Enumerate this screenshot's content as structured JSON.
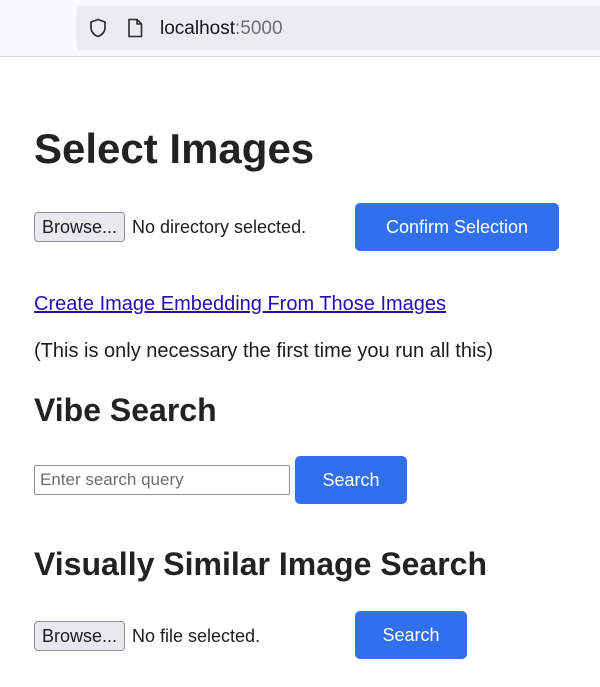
{
  "browser": {
    "url_host": "localhost",
    "url_port": ":5000",
    "icons": [
      "shield-icon",
      "page-icon"
    ]
  },
  "select_images": {
    "title": "Select Images",
    "browse_label": "Browse...",
    "status": "No directory selected.",
    "confirm_label": "Confirm Selection"
  },
  "embedding": {
    "link_text": "Create Image Embedding From Those Images",
    "note": "(This is only necessary the first time you run all this)"
  },
  "vibe_search": {
    "title": "Vibe Search",
    "placeholder": "Enter search query",
    "value": "",
    "button_label": "Search"
  },
  "similar_search": {
    "title": "Visually Similar Image Search",
    "browse_label": "Browse...",
    "status": "No file selected.",
    "button_label": "Search"
  },
  "colors": {
    "primary_button": "#2f6ff0",
    "link": "#2a0dad"
  }
}
